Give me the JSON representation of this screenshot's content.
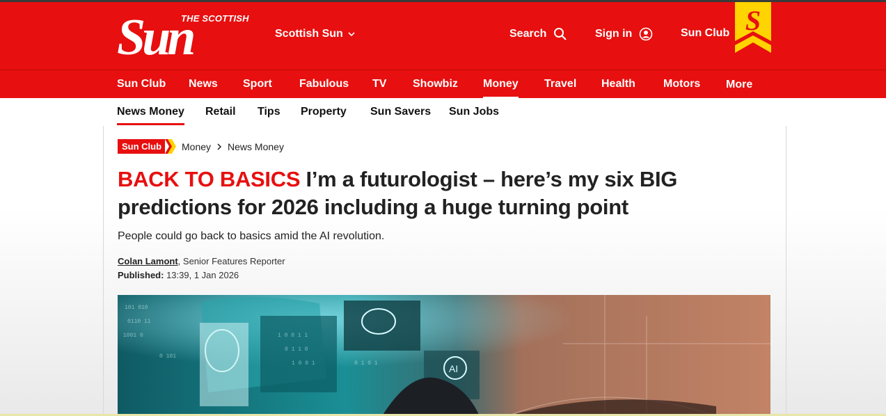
{
  "header": {
    "logo_small": "THE SCOTTISH",
    "logo_main": "Sun",
    "edition": "Scottish Sun",
    "search": "Search",
    "sign_in": "Sign in",
    "sun_club": "Sun Club",
    "badge_letter": "S"
  },
  "nav": {
    "items": [
      "Sun Club",
      "News",
      "Sport",
      "Fabulous",
      "TV",
      "Showbiz",
      "Money",
      "Travel",
      "Health",
      "Motors",
      "More"
    ],
    "active": "Money"
  },
  "subnav": {
    "items": [
      "News Money",
      "Retail",
      "Tips",
      "Property",
      "Sun Savers",
      "Sun Jobs"
    ],
    "active": "News Money"
  },
  "article": {
    "tag": "Sun Club",
    "breadcrumb": [
      "Money",
      "News Money"
    ],
    "kicker": "BACK TO BASICS",
    "headline": "I’m a futurologist – here’s my six BIG predictions for 2026 including a huge turning point",
    "standfirst": "People could go back to basics amid the AI revolution.",
    "author": "Colan Lamont",
    "author_role": ", Senior Features Reporter",
    "published_label": "Published:",
    "published_time": " 13:39, 1 Jan 2026"
  },
  "colors": {
    "brand_red": "#e70f0f",
    "badge_yellow": "#ffd400"
  }
}
